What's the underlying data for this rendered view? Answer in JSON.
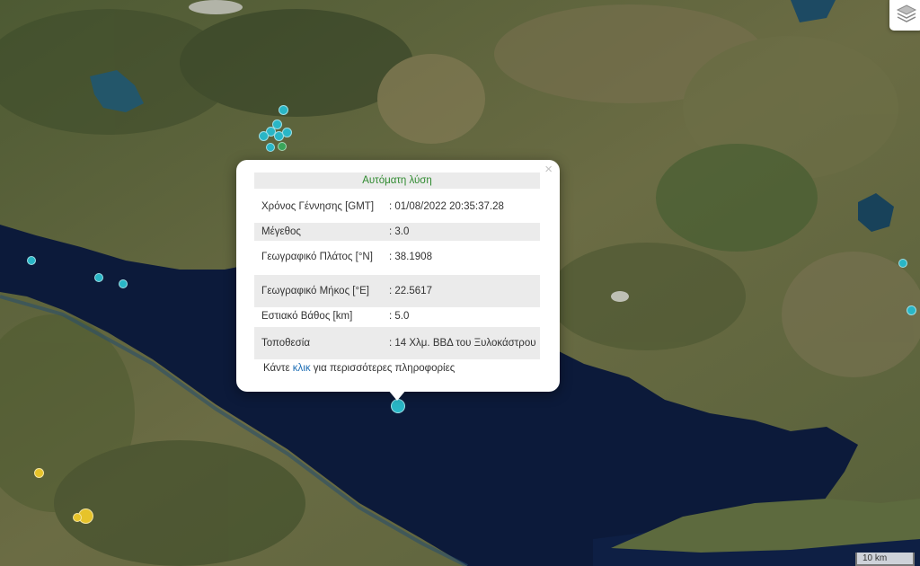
{
  "popup": {
    "title": "Αυτόματη λύση",
    "close_glyph": "×",
    "rows": [
      {
        "label": "Χρόνος Γέννησης [GMT]",
        "value": ": 01/08/2022 20:35:37.28"
      },
      {
        "label": "Μέγεθος",
        "value": ": 3.0"
      },
      {
        "label": "Γεωγραφικό Πλάτος [°N]",
        "value": ": 38.1908"
      },
      {
        "label": "Γεωγραφικό Μήκος [°E]",
        "value": ": 22.5617"
      },
      {
        "label": "Εστιακό Βάθος [km]",
        "value": ": 5.0"
      },
      {
        "label": "Τοποθεσία",
        "value": ": 14 Χλμ. ΒΒΔ του Ξυλοκάστρου"
      }
    ],
    "more_prefix": "Κάντε ",
    "more_link": "κλικ",
    "more_suffix": " για περισσότερες πληροφορίες"
  },
  "scale_label": "10 km",
  "layers_icon": "layers-icon",
  "colors": {
    "marker_cyan": "#29b6c6",
    "marker_green": "#3aa55a",
    "marker_yellow": "#e6c32a",
    "sea": "#0c1a3a",
    "land": "#5e6a3b",
    "title_text": "#2f8a2f",
    "link": "#1f6fb5"
  }
}
